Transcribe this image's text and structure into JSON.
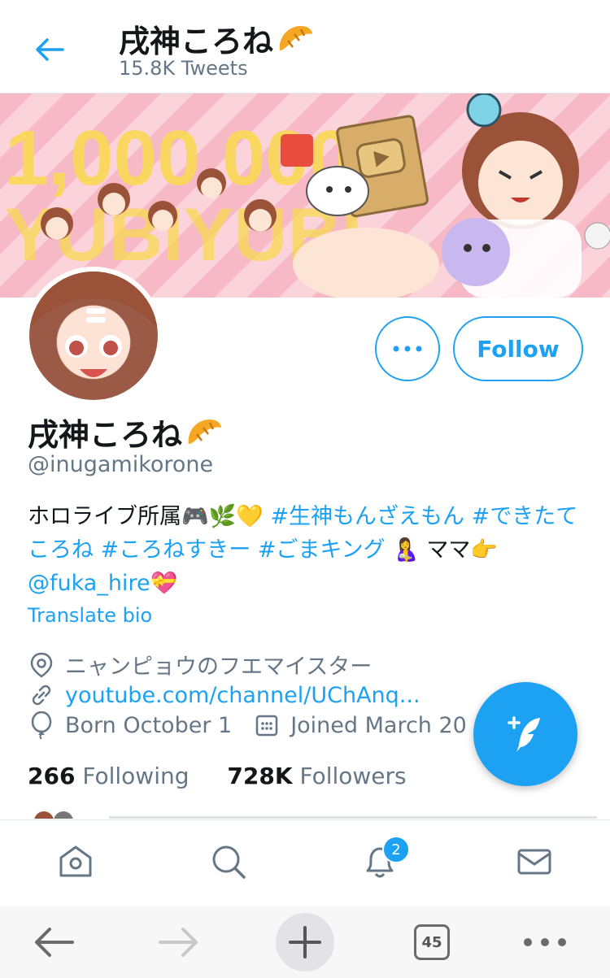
{
  "header": {
    "title": "戌神ころね",
    "tweet_count": "15.8K Tweets"
  },
  "banner": {
    "headline": "1,000,000",
    "headline2": "YUBIYUBI"
  },
  "profile": {
    "name": "戌神ころね",
    "handle": "@inugamikorone",
    "bio_prefix": "ホロライブ所属🎮🌿💛 ",
    "hashtags": [
      "#生神もんざえもん",
      "#できたてころね",
      "#ころねすきー",
      "#ごまキング"
    ],
    "bio_mid": " 🤱 ママ👉",
    "mention": "@fuka_hire",
    "bio_suffix": "💝",
    "translate_label": "Translate bio",
    "location": "ニャンピョウのフエマイスター",
    "website": "youtube.com/channel/UChAnq...",
    "birthday": "Born October 1",
    "joined": "Joined March 20",
    "following_count": "266",
    "following_label": "Following",
    "followers_count": "728K",
    "followers_label": "Followers"
  },
  "actions": {
    "follow_label": "Follow"
  },
  "tabbar": {
    "notifications_badge": "2"
  },
  "browser": {
    "tab_count": "45"
  },
  "colors": {
    "accent": "#1da1f2",
    "secondary_text": "#657786"
  }
}
